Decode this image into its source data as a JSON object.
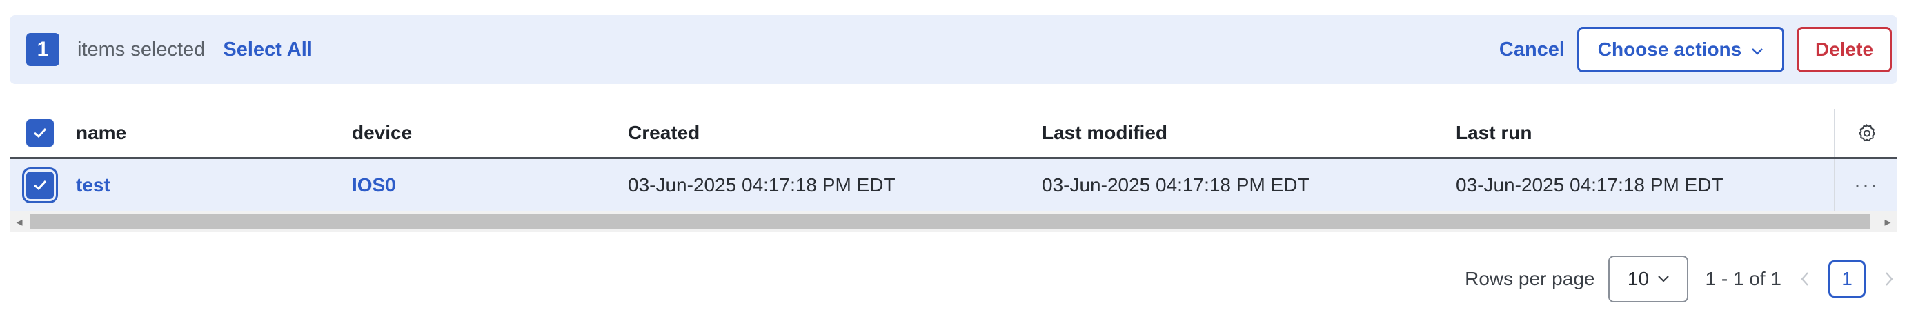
{
  "selection_bar": {
    "count": "1",
    "text": "items selected",
    "select_all": "Select All",
    "cancel": "Cancel",
    "choose_actions": "Choose actions",
    "delete": "Delete"
  },
  "table": {
    "columns": [
      "name",
      "device",
      "Created",
      "Last modified",
      "Last run"
    ],
    "rows": [
      {
        "name": "test",
        "device": "IOS0",
        "created": "03-Jun-2025 04:17:18 PM EDT",
        "last_modified": "03-Jun-2025 04:17:18 PM EDT",
        "last_run": "03-Jun-2025 04:17:18 PM EDT",
        "more": "···"
      }
    ]
  },
  "pagination": {
    "rows_per_page_label": "Rows per page",
    "rows_per_page_value": "10",
    "range": "1 - 1 of 1",
    "current_page": "1"
  },
  "colors": {
    "accent": "#2d5cc8",
    "danger": "#c93540",
    "selection_bg": "#e9effb"
  },
  "icons": [
    "check-icon",
    "chevron-down-icon",
    "gear-icon",
    "more-horizontal-icon",
    "chevron-left-icon",
    "chevron-right-icon"
  ]
}
